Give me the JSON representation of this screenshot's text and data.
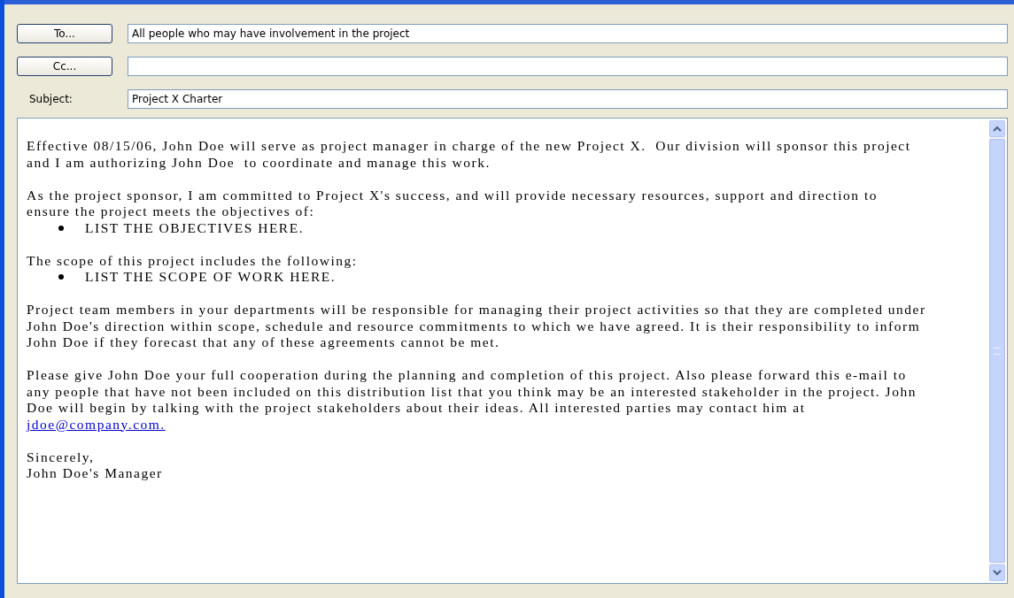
{
  "header": {
    "to_button": "To...",
    "to_value": "All people who may have involvement in the project",
    "cc_button": "Cc...",
    "subject_label": "Subject:",
    "subject_value": "Project X Charter"
  },
  "body": [
    {
      "kind": "paragraph",
      "lines": [
        "Effective 08/15/06, John Doe will serve as project manager in charge of the new Project X.  Our division will sponsor this project",
        "and I am authorizing John Doe  to coordinate and manage this work."
      ]
    },
    {
      "kind": "paragraph",
      "lines": [
        "As the project sponsor, I am committed to Project X's success, and will provide necessary resources, support and direction to",
        "ensure the project meets the objectives of:"
      ]
    },
    {
      "kind": "bullet",
      "text": "LIST THE OBJECTIVES HERE."
    },
    {
      "kind": "paragraph",
      "lines": [
        "The scope of this project includes the following:"
      ]
    },
    {
      "kind": "bullet",
      "text": "LIST THE SCOPE OF WORK HERE."
    },
    {
      "kind": "paragraph",
      "lines": [
        "Project team members in your departments will be responsible for managing their project activities so that they are completed under",
        "John Doe's direction within scope, schedule and resource commitments to which we have agreed. It is their responsibility to inform",
        "John Doe if they forecast that any of these agreements cannot be met."
      ]
    },
    {
      "kind": "paragraph",
      "lines": [
        "Please give John Doe your full cooperation during the planning and completion of this project. Also please forward this e-mail to",
        "any people that have not been included on this distribution list that you think may be an interested stakeholder in the project. John",
        "Doe will begin by talking with the project stakeholders about their ideas. All interested parties may contact him at"
      ]
    },
    {
      "kind": "link",
      "text": "jdoe@company.com."
    },
    {
      "kind": "paragraph",
      "lines": [
        "Sincerely,",
        "John Doe's Manager"
      ]
    }
  ]
}
